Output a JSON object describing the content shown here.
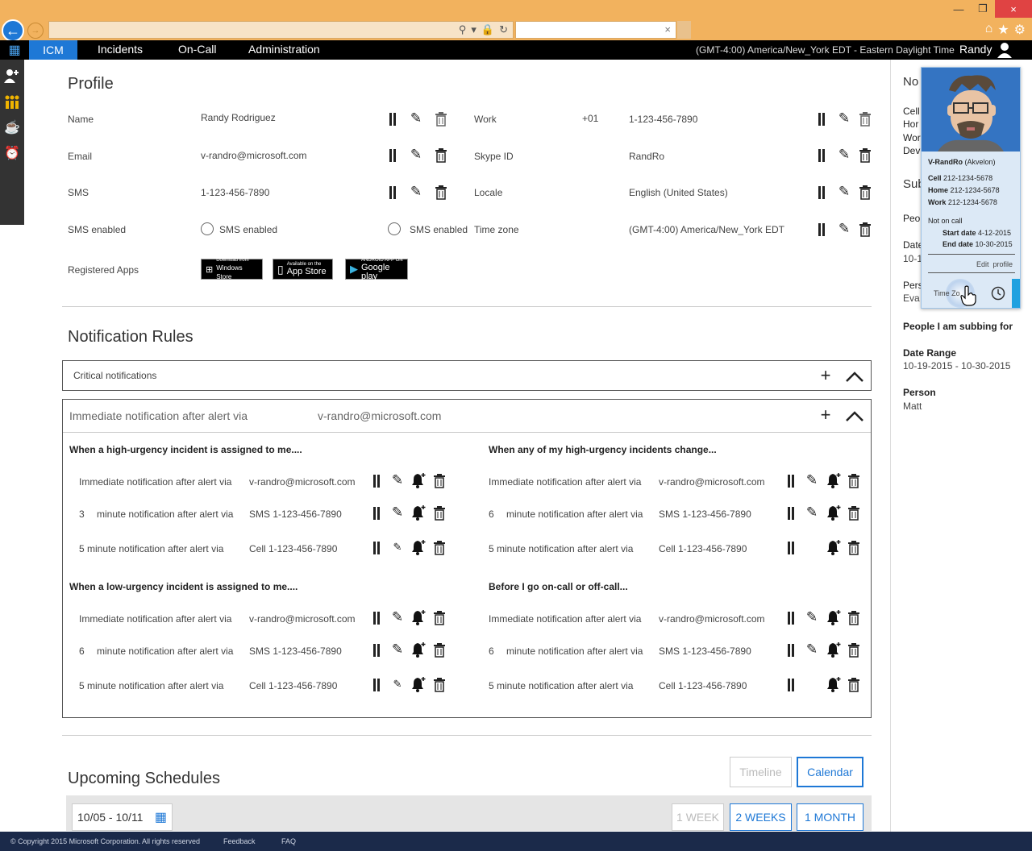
{
  "browser": {
    "close_glyph": "×",
    "tab_close_glyph": "×"
  },
  "nav": {
    "brand": "ICM",
    "items": [
      "Incidents",
      "On-Call",
      "Administration"
    ],
    "timezone": "(GMT-4:00) America/New_York EDT - Eastern Daylight Time",
    "user": "Randy"
  },
  "profile": {
    "title": "Profile",
    "left": [
      {
        "label": "Name",
        "value": "Randy Rodriguez"
      },
      {
        "label": "Email",
        "value": "v-randro@microsoft.com"
      },
      {
        "label": "SMS",
        "value": "1-123-456-7890"
      },
      {
        "label": "SMS enabled",
        "value": "SMS enabled",
        "value2": "SMS enabled"
      }
    ],
    "right": [
      {
        "label": "Work",
        "prefix": "+01",
        "value": "1-123-456-7890"
      },
      {
        "label": "Skype ID",
        "value": "RandRo"
      },
      {
        "label": "Locale",
        "value": "English (United States)"
      },
      {
        "label": "Time zone",
        "value": "(GMT-4:00) America/New_York EDT"
      }
    ],
    "apps_label": "Registered Apps",
    "apps": [
      {
        "small": "Download from",
        "big": "Windows Store",
        "icon": "windows-icon"
      },
      {
        "small": "Available on the",
        "big": "App Store",
        "icon": "apple-icon"
      },
      {
        "small": "ANDROID APP ON",
        "big": "Google play",
        "icon": "play-icon"
      }
    ]
  },
  "notifications": {
    "title": "Notification Rules",
    "critical": "Critical notifications",
    "immediate_label": "Immediate notification after alert via",
    "immediate_value": "v-randro@microsoft.com",
    "groups": [
      {
        "heading": "When a high-urgency incident is assigned to me....",
        "rows": [
          {
            "text": "Immediate notification after alert via",
            "value": "v-randro@microsoft.com"
          },
          {
            "num": "3",
            "text": "minute notification after alert via",
            "value": "SMS 1-123-456-7890"
          },
          {
            "text": "5 minute notification after alert via",
            "value": "Cell 1-123-456-7890"
          }
        ]
      },
      {
        "heading": "When any of my high-urgency incidents change...",
        "rows": [
          {
            "text": "Immediate notification after alert via",
            "value": "v-randro@microsoft.com"
          },
          {
            "num": "6",
            "text": "minute notification after alert via",
            "value": "SMS 1-123-456-7890"
          },
          {
            "text": "5 minute notification after alert via",
            "value": "Cell 1-123-456-7890"
          }
        ]
      },
      {
        "heading": "When a low-urgency incident is assigned to me....",
        "rows": [
          {
            "text": "Immediate notification after alert via",
            "value": "v-randro@microsoft.com"
          },
          {
            "num": "6",
            "text": "minute notification after alert via",
            "value": "SMS 1-123-456-7890"
          },
          {
            "text": "5 minute notification after alert via",
            "value": "Cell 1-123-456-7890"
          }
        ]
      },
      {
        "heading": "Before I go on-call or off-call...",
        "rows": [
          {
            "text": "Immediate notification after alert via",
            "value": "v-randro@microsoft.com"
          },
          {
            "num": "6",
            "text": "minute notification after alert via",
            "value": "SMS 1-123-456-7890"
          },
          {
            "text": "5 minute notification after alert via",
            "value": "Cell 1-123-456-7890"
          }
        ]
      }
    ]
  },
  "schedules": {
    "title": "Upcoming Schedules",
    "timeline": "Timeline",
    "calendar": "Calendar",
    "date_range": "10/05 - 10/11",
    "week": "1 WEEK",
    "two_weeks": "2 WEEKS",
    "month": "1 MONTH"
  },
  "right_panel": {
    "no_trunc": "No",
    "cell_trunc": "Cell",
    "home_trunc": "Hor",
    "work_trunc": "Wor",
    "dev_trunc": "Dev",
    "sub_trunc": "Sub",
    "peo_trunc": "Peo",
    "date_trunc": "Date",
    "date_val_trunc": "10-1",
    "pers_trunc": "Pers",
    "eva_trunc": "Eva",
    "subbing_for": "People I am subbing for",
    "date_range_label": "Date Range",
    "date_range_value": "10-19-2015 - 10-30-2015",
    "person_label": "Person",
    "person_value": "Matt"
  },
  "popup": {
    "name": "V-RandRo",
    "org": "(Akvelon)",
    "cell_label": "Cell",
    "cell": "212-1234-5678",
    "home_label": "Home",
    "home": "212-1234-5678",
    "work_label": "Work",
    "work": "212-1234-5678",
    "status": "Not on call",
    "start_label": "Start date",
    "start": "4-12-2015",
    "end_label": "End date",
    "end": "10-30-2015",
    "edit": "Edit",
    "profile": "profile",
    "timezone_trunc": "Time Zo"
  },
  "footer": {
    "copyright": "© Copyright 2015 Microsoft Corporation.",
    "rights": "All rights reserved",
    "feedback": "Feedback",
    "faq": "FAQ"
  },
  "colors": {
    "accent": "#1e78d6",
    "browser_chrome": "#f2b25e",
    "footer": "#1b2a4a"
  }
}
